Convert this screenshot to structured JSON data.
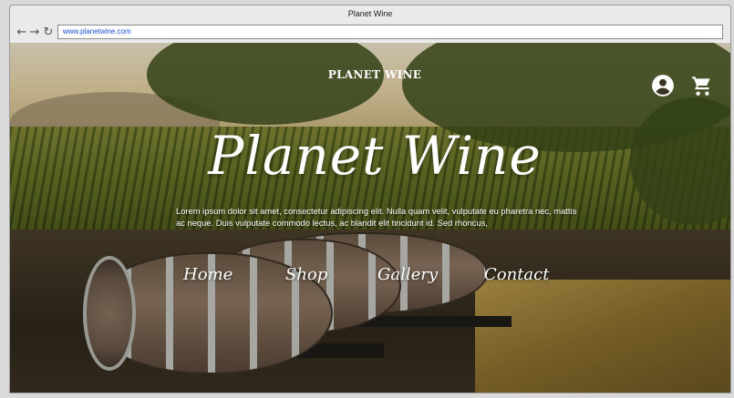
{
  "window": {
    "title": "Planet Wine"
  },
  "toolbar": {
    "back_icon": "back-arrow-icon",
    "forward_icon": "forward-arrow-icon",
    "reload_icon": "reload-icon",
    "url": "www.planetwine.com"
  },
  "header": {
    "brand": "PLANET WINE",
    "account_icon": "account-circle-icon",
    "cart_icon": "shopping-cart-icon"
  },
  "hero": {
    "title": "Planet Wine",
    "text": "Lorem ipsum dolor sit amet, consectetur adipiscing elit. Nulla quam velit, vulputate eu pharetra nec, mattis ac neque. Duis vulputate commodo lectus, ac blandit elit tincidunt id. Sed rhoncus,"
  },
  "nav": {
    "items": [
      "Home",
      "Shop",
      "Gallery",
      "Contact"
    ]
  }
}
